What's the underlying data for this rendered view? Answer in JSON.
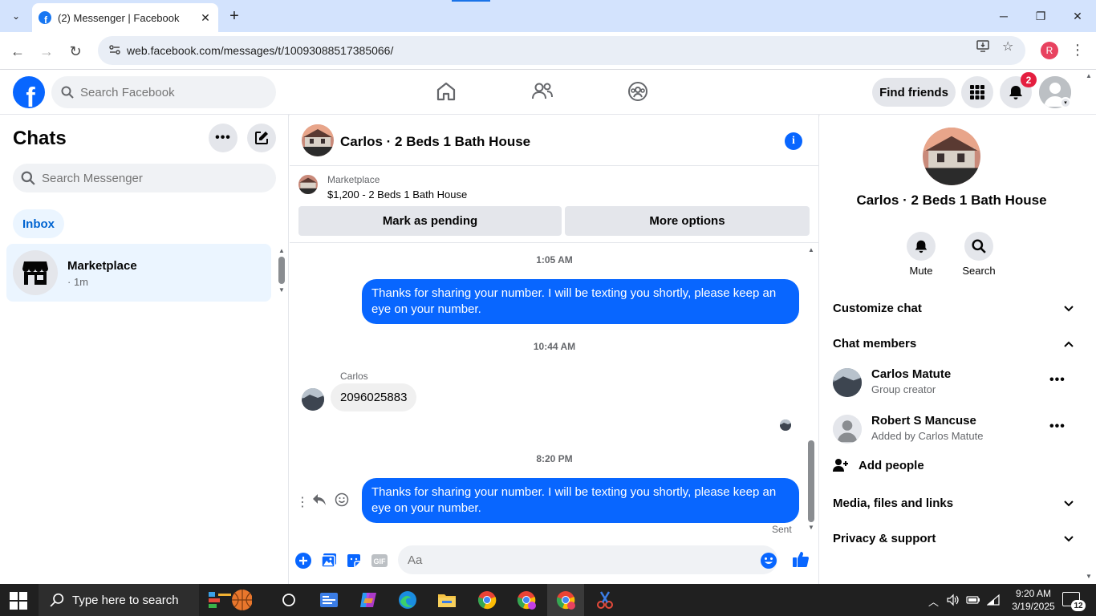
{
  "browser": {
    "tab_title": "(2) Messenger | Facebook",
    "url": "web.facebook.com/messages/t/10093088517385066/",
    "profile_initial": "R"
  },
  "fb_header": {
    "search_placeholder": "Search Facebook",
    "find_friends_label": "Find friends",
    "notification_count": "2"
  },
  "chat_list": {
    "title": "Chats",
    "search_placeholder": "Search Messenger",
    "filter_label": "Inbox",
    "items": [
      {
        "name": "Marketplace",
        "time": "· 1m"
      }
    ]
  },
  "conversation": {
    "title": "Carlos · 2 Beds 1 Bath House",
    "marketplace": {
      "label": "Marketplace",
      "listing": "$1,200 - 2 Beds 1 Bath House",
      "mark_pending_label": "Mark as pending",
      "more_options_label": "More options"
    },
    "messages": [
      {
        "timestamp": "1:05 AM"
      },
      {
        "text": "Thanks for sharing your number. I will be texting you shortly, please keep an eye on your number."
      },
      {
        "timestamp": "10:44 AM"
      },
      {
        "sender": "Carlos",
        "text": "2096025883"
      },
      {
        "timestamp": "8:20 PM"
      },
      {
        "text": "Thanks for sharing your number. I will be texting you shortly, please keep an eye on your number.",
        "status": "Sent"
      }
    ],
    "composer_placeholder": "Aa"
  },
  "info_panel": {
    "name": "Carlos · 2 Beds 1 Bath House",
    "actions": [
      {
        "label": "Mute"
      },
      {
        "label": "Search"
      }
    ],
    "sections": {
      "customize": "Customize chat",
      "members": "Chat members",
      "media": "Media, files and links",
      "privacy": "Privacy & support"
    },
    "members": [
      {
        "name": "Carlos Matute",
        "role": "Group creator"
      },
      {
        "name": "Robert S Mancuse",
        "role": "Added by Carlos Matute"
      }
    ],
    "add_people_label": "Add people"
  },
  "taskbar": {
    "search_placeholder": "Type here to search",
    "time": "9:20 AM",
    "date": "3/19/2025",
    "notification_count": "12"
  },
  "colors": {
    "accent": "#0866ff",
    "badge": "#e41e3f",
    "selected_bg": "#ebf5ff"
  }
}
